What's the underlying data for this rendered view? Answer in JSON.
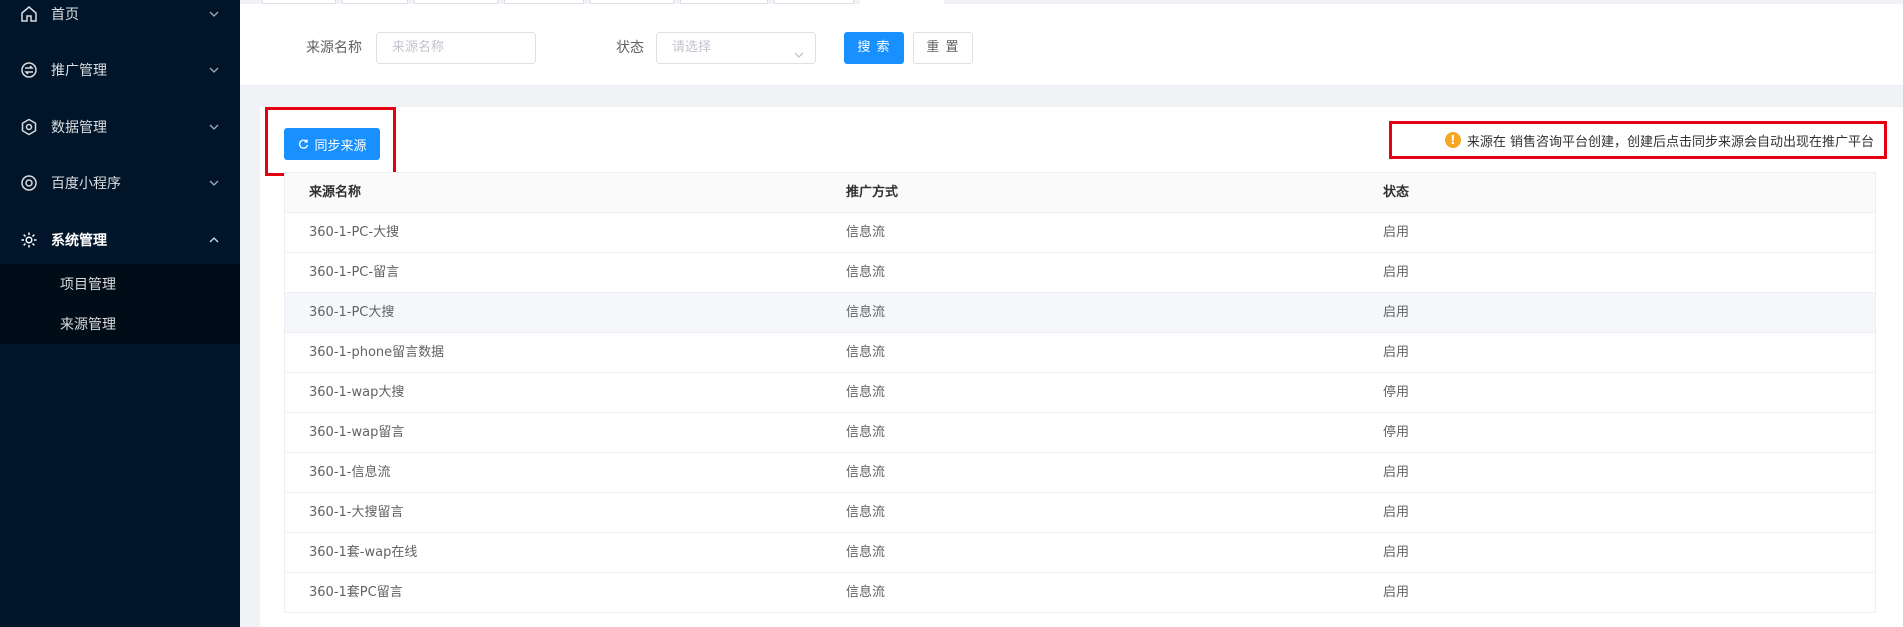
{
  "sidebar": {
    "items": [
      {
        "label": "首页",
        "icon": "home-icon"
      },
      {
        "label": "推广管理",
        "icon": "promotion-icon"
      },
      {
        "label": "数据管理",
        "icon": "data-icon"
      },
      {
        "label": "百度小程序",
        "icon": "mini-program-icon"
      },
      {
        "label": "系统管理",
        "icon": "gear-icon"
      }
    ],
    "sub_items": [
      {
        "label": "项目管理"
      },
      {
        "label": "来源管理"
      }
    ]
  },
  "search": {
    "source_name_label": "来源名称",
    "source_name_placeholder": "来源名称",
    "status_label": "状态",
    "status_placeholder": "请选择",
    "search_button": "搜 索",
    "reset_button": "重 置"
  },
  "toolbar": {
    "sync_button": "同步来源"
  },
  "notice": {
    "text": "来源在 销售咨询平台创建，创建后点击同步来源会自动出现在推广平台"
  },
  "table": {
    "columns": [
      "来源名称",
      "推广方式",
      "状态"
    ],
    "rows": [
      [
        "360-1-PC-大搜",
        "信息流",
        "启用"
      ],
      [
        "360-1-PC-留言",
        "信息流",
        "启用"
      ],
      [
        "360-1-PC大搜",
        "信息流",
        "启用"
      ],
      [
        "360-1-phone留言数据",
        "信息流",
        "启用"
      ],
      [
        "360-1-wap大搜",
        "信息流",
        "停用"
      ],
      [
        "360-1-wap留言",
        "信息流",
        "停用"
      ],
      [
        "360-1-信息流",
        "信息流",
        "启用"
      ],
      [
        "360-1-大搜留言",
        "信息流",
        "启用"
      ],
      [
        "360-1套-wap在线",
        "信息流",
        "启用"
      ],
      [
        "360-1套PC留言",
        "信息流",
        "启用"
      ]
    ]
  },
  "colors": {
    "sidebar_bg": "#001529",
    "primary": "#1890ff",
    "highlight_border": "#e60012",
    "warning": "#f5a623"
  }
}
